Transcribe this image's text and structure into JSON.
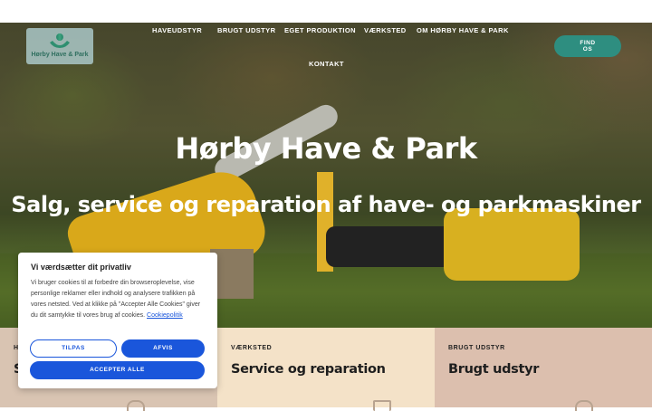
{
  "brand": {
    "logo_text": "Hørby Have & Park"
  },
  "nav": {
    "items": [
      {
        "label": "HAVEUDSTYR"
      },
      {
        "label": "BRUGT UDSTYR"
      },
      {
        "label": "EGET PRODUKTION"
      },
      {
        "label": "VÆRKSTED"
      },
      {
        "label": "OM HØRBY HAVE & PARK"
      },
      {
        "label": "KONTAKT"
      }
    ],
    "cta_label": "FIND OS"
  },
  "hero": {
    "title": "Hørby Have & Park",
    "subtitle": "Salg, service og reparation af have- og parkmaskiner"
  },
  "cards": [
    {
      "label": "H",
      "title": "S"
    },
    {
      "label": "VÆRKSTED",
      "title": "Service og reparation"
    },
    {
      "label": "BRUGT UDSTYR",
      "title": "Brugt udstyr"
    }
  ],
  "cookie": {
    "title": "Vi værdsætter dit privatliv",
    "body": "Vi bruger cookies til at forbedre din browseroplevelse, vise personlige reklamer eller indhold og analysere trafikken på vores netsted. Ved at klikke på \"Accepter Alle Cookies\" giver du dit samtykke til vores brug af cookies.",
    "link_label": "Cookiepolitik",
    "customize_label": "TILPAS",
    "reject_label": "AFVIS",
    "accept_label": "ACCEPTER ALLE"
  },
  "colors": {
    "accent_teal": "#2e8e80",
    "cookie_blue": "#1a56db",
    "card_1": "#d9c4b2",
    "card_2": "#f4e2c8",
    "card_3": "#dcbfae"
  },
  "icons": [
    "logo-hands-icon",
    "card-icon"
  ]
}
